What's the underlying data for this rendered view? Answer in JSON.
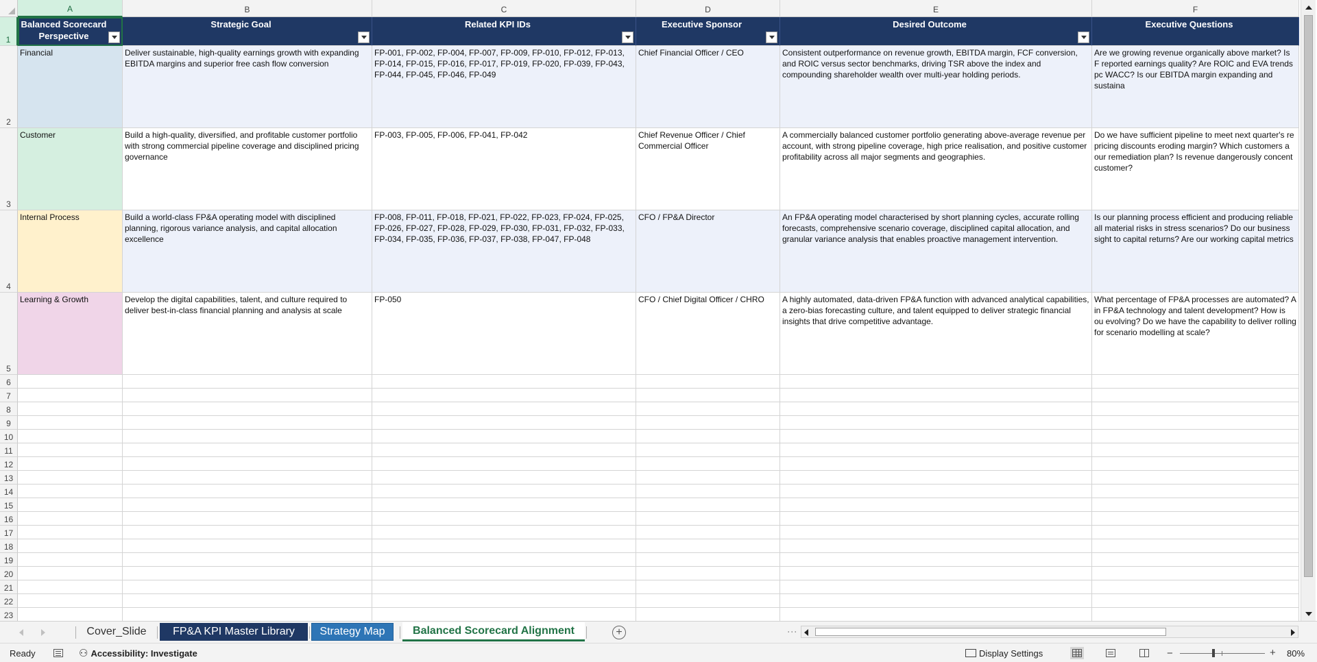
{
  "columns": [
    "A",
    "B",
    "C",
    "D",
    "E",
    "F"
  ],
  "rows": [
    "1",
    "2",
    "3",
    "4",
    "5",
    "6",
    "7",
    "8",
    "9",
    "10",
    "11",
    "12",
    "13",
    "14",
    "15",
    "16",
    "17",
    "18",
    "19",
    "20",
    "21",
    "22",
    "23"
  ],
  "headers": [
    "Balanced Scorecard Perspective",
    "Strategic Goal",
    "Related KPI IDs",
    "Executive Sponsor",
    "Desired Outcome",
    "Executive Questions"
  ],
  "data_rows": [
    {
      "perspective": "Financial",
      "goal": "Deliver sustainable, high-quality earnings growth with expanding EBITDA margins and superior free cash flow conversion",
      "kpis": "FP-001, FP-002, FP-004, FP-007, FP-009, FP-010, FP-012, FP-013, FP-014, FP-015, FP-016, FP-017, FP-019, FP-020, FP-039, FP-043, FP-044, FP-045, FP-046, FP-049",
      "sponsor": "Chief Financial Officer / CEO",
      "outcome": "Consistent outperformance on revenue growth, EBITDA margin, FCF conversion, and ROIC versus sector benchmarks, driving TSR above the index and compounding shareholder wealth over multi-year holding periods.",
      "questions": "Are we growing revenue organically above market? Is F reported earnings quality? Are ROIC and EVA trends pc WACC? Is our EBITDA margin expanding and sustaina"
    },
    {
      "perspective": "Customer",
      "goal": "Build a high-quality, diversified, and profitable customer portfolio with strong commercial pipeline coverage and disciplined pricing governance",
      "kpis": "FP-003, FP-005, FP-006, FP-041, FP-042",
      "sponsor": "Chief Revenue Officer / Chief Commercial Officer",
      "outcome": "A commercially balanced customer portfolio generating above-average revenue per account, with strong pipeline coverage, high price realisation, and positive customer profitability across all major segments and geographies.",
      "questions": "Do we have sufficient pipeline to meet next quarter's re pricing discounts eroding margin? Which customers a our remediation plan? Is revenue dangerously concent customer?"
    },
    {
      "perspective": "Internal Process",
      "goal": "Build a world-class FP&A operating model with disciplined planning, rigorous variance analysis, and capital allocation excellence",
      "kpis": "FP-008, FP-011, FP-018, FP-021, FP-022, FP-023, FP-024, FP-025, FP-026, FP-027, FP-028, FP-029, FP-030, FP-031, FP-032, FP-033, FP-034, FP-035, FP-036, FP-037, FP-038, FP-047, FP-048",
      "sponsor": "CFO / FP&A Director",
      "outcome": "An FP&A operating model characterised by short planning cycles, accurate rolling forecasts, comprehensive scenario coverage, disciplined capital allocation, and granular variance analysis that enables proactive management intervention.",
      "questions": "Is our planning process efficient and producing reliable all material risks in stress scenarios? Do our business sight to capital returns? Are our working capital metrics"
    },
    {
      "perspective": "Learning & Growth",
      "goal": "Develop the digital capabilities, talent, and culture required to deliver best-in-class financial planning and analysis at scale",
      "kpis": "FP-050",
      "sponsor": "CFO / Chief Digital Officer / CHRO",
      "outcome": "A highly automated, data-driven FP&A function with advanced analytical capabilities, a zero-bias forecasting culture, and talent equipped to deliver strategic financial insights that drive competitive advantage.",
      "questions": "What percentage of FP&A processes are automated? A in FP&A technology and talent development? How is ou evolving? Do we have the capability to deliver rolling for scenario modelling at scale?"
    }
  ],
  "colors": {
    "header_navy": "#1f3864",
    "band_blue": "#edf1fa",
    "financial": "#d6e4ef",
    "customer": "#d5efe0",
    "internal_process": "#fff1cc",
    "learning_growth": "#f0d5e8",
    "excel_green": "#217346"
  },
  "tabs": {
    "t1": "Cover_Slide",
    "t2": "FP&A KPI Master Library",
    "t3": "Strategy Map",
    "t4": "Balanced Scorecard Alignment",
    "active": "Balanced Scorecard Alignment"
  },
  "status": {
    "ready": "Ready",
    "accessibility": "Accessibility: Investigate",
    "display_settings": "Display Settings",
    "zoom": "80%",
    "zoom_level": 0.8
  },
  "icons": [
    "select-all-corner-icon",
    "filter-dropdown-icon",
    "scroll-up-icon",
    "scroll-down-icon",
    "scroll-left-icon",
    "scroll-right-icon",
    "add-sheet-icon",
    "macro-record-icon",
    "accessibility-icon",
    "display-settings-icon",
    "normal-view-icon",
    "page-layout-icon",
    "page-break-icon",
    "zoom-out-icon",
    "zoom-in-icon"
  ]
}
